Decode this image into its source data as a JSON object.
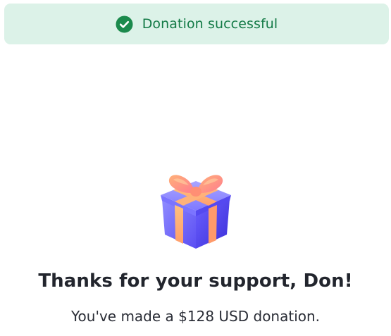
{
  "toast": {
    "icon": "check-circle-icon",
    "message": "Donation successful",
    "color": "#137a46",
    "background": "#dcf2e8"
  },
  "illustration": {
    "icon": "gift-box-icon"
  },
  "confirmation": {
    "headline": "Thanks for your support, Don!",
    "subline": "You've made a $128 USD donation."
  }
}
